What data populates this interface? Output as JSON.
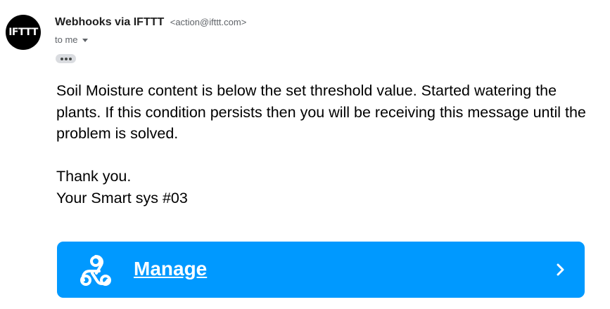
{
  "sender": {
    "avatar_text": "IFTTT",
    "name": "Webhooks via IFTTT",
    "email": "<action@ifttt.com>"
  },
  "recipient": {
    "label": "to me"
  },
  "body": {
    "paragraph1": "Soil Moisture content is below the set threshold value. Started watering the plants. If this condition persists then you will be receiving this message until the problem is solved.",
    "line_thanks": "Thank you.",
    "line_signature": "Your Smart sys #03"
  },
  "manage_button": {
    "label": "Manage",
    "icon": "webhook-icon",
    "trailing_icon": "chevron-right-icon"
  },
  "colors": {
    "button_bg": "#0099ff",
    "avatar_bg": "#000000"
  }
}
